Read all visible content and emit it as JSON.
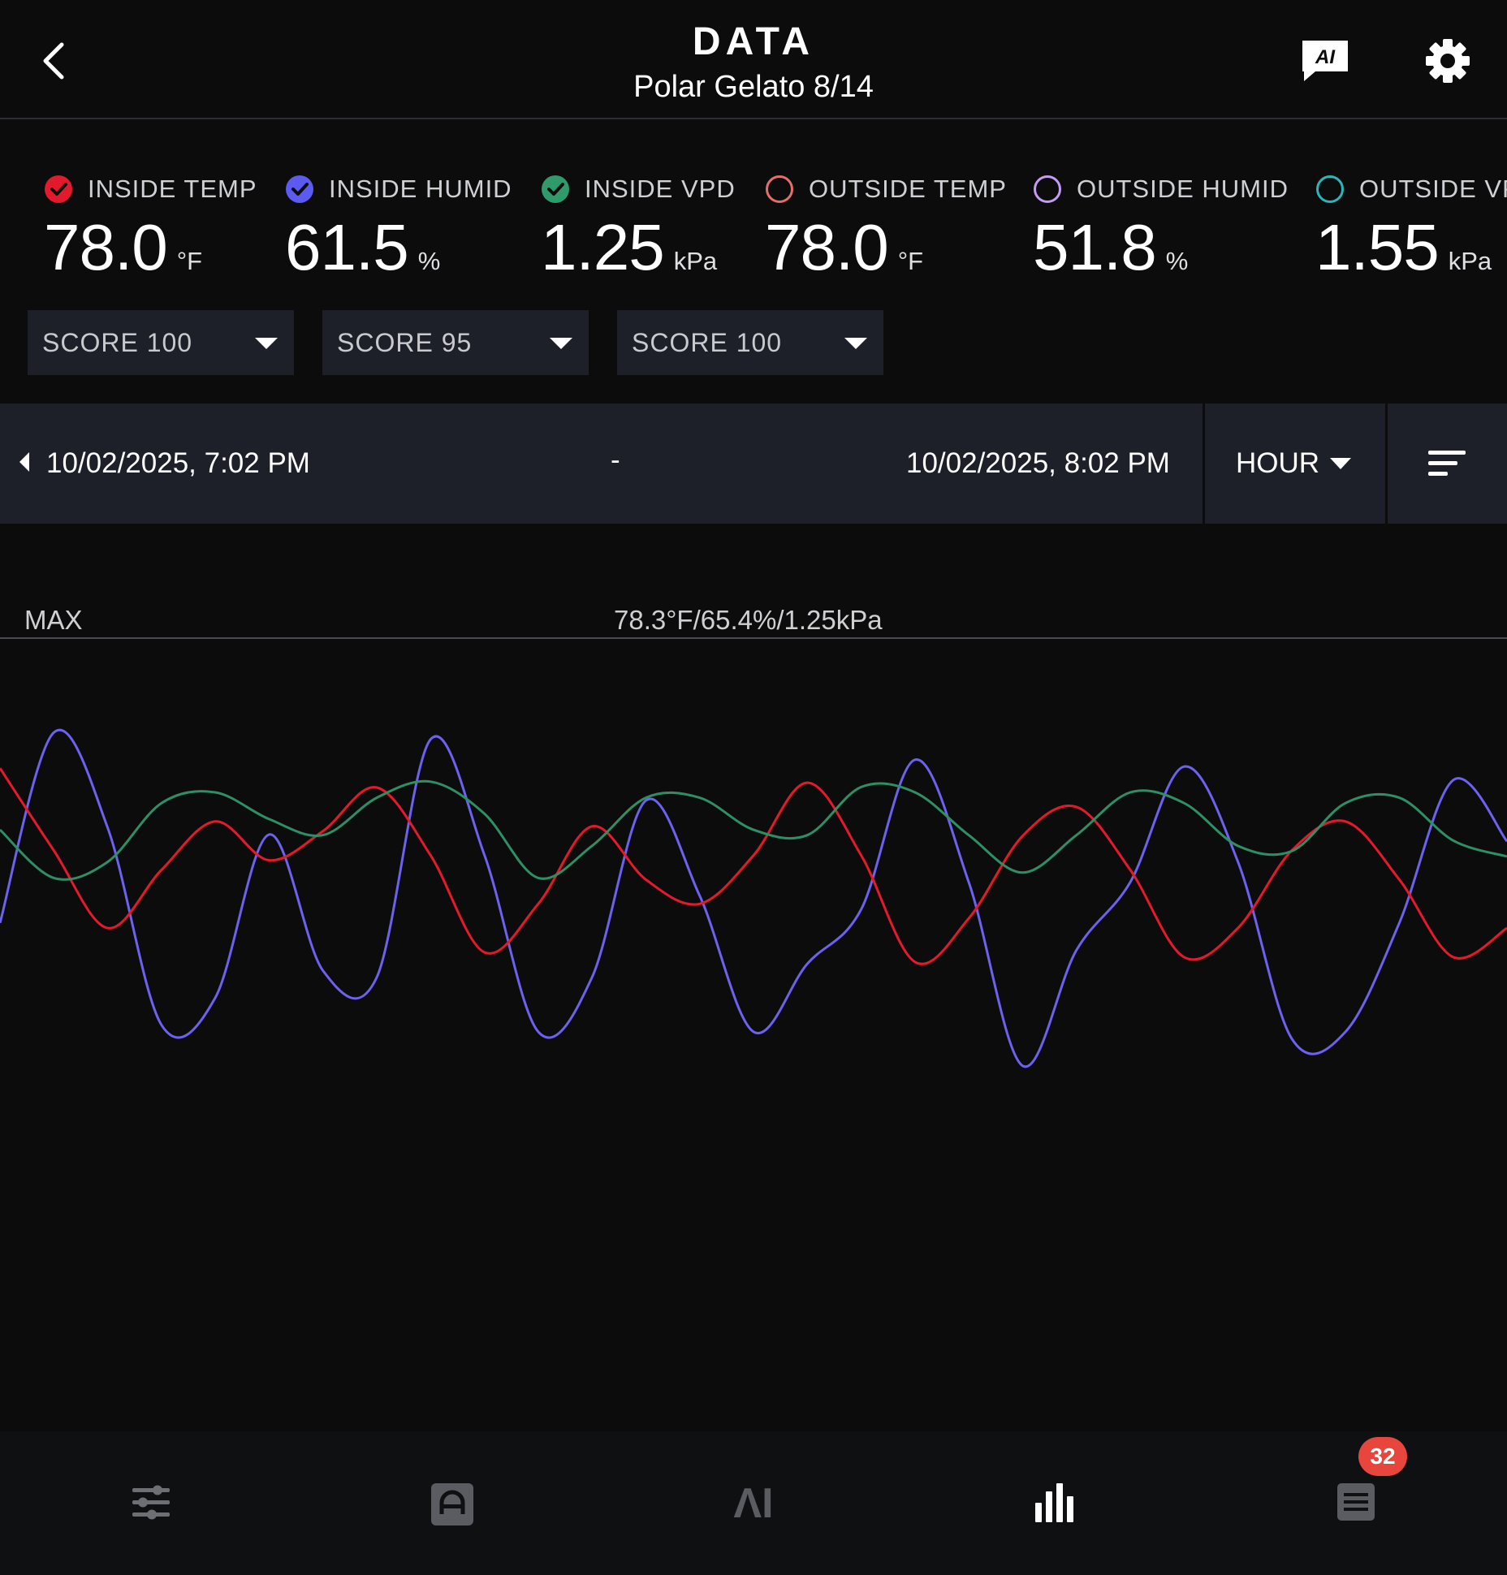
{
  "header": {
    "title": "DATA",
    "subtitle": "Polar Gelato 8/14"
  },
  "metrics": [
    {
      "label": "INSIDE TEMP",
      "value": "78.0",
      "unit": "°F",
      "color": "#e3192c",
      "checked": true
    },
    {
      "label": "INSIDE HUMID",
      "value": "61.5",
      "unit": "%",
      "color": "#5b5bef",
      "checked": true
    },
    {
      "label": "INSIDE VPD",
      "value": "1.25",
      "unit": "kPa",
      "color": "#2f9a6a",
      "checked": true
    },
    {
      "label": "OUTSIDE TEMP",
      "value": "78.0",
      "unit": "°F",
      "color": "#e36e6a",
      "checked": false
    },
    {
      "label": "OUTSIDE HUMID",
      "value": "51.8",
      "unit": "%",
      "color": "#c69bf2",
      "checked": false
    },
    {
      "label": "OUTSIDE VPD",
      "value": "1.55",
      "unit": "kPa",
      "color": "#2bb5b8",
      "checked": false
    }
  ],
  "scores": [
    "SCORE 100",
    "SCORE 95",
    "SCORE 100"
  ],
  "range": {
    "start": "10/02/2025, 7:02 PM",
    "separator": "-",
    "end": "10/02/2025, 8:02 PM",
    "period": "HOUR"
  },
  "chart_labels": {
    "max_label": "MAX",
    "max_value": "78.3°F/65.4%/1.25kPa"
  },
  "chart_data": {
    "type": "line",
    "xlabel": "",
    "ylabel": "",
    "grid": false,
    "legend": "none",
    "series": [
      {
        "name": "INSIDE HUMID",
        "color": "#6d62f0",
        "values": [
          62.0,
          64.8,
          63.4,
          60.5,
          60.9,
          63.3,
          61.3,
          61.2,
          64.7,
          63.0,
          60.4,
          61.2,
          63.8,
          62.4,
          60.4,
          61.4,
          62.2,
          64.4,
          62.6,
          59.9,
          61.6,
          62.6,
          64.3,
          62.9,
          60.3,
          60.4,
          62.0,
          64.1,
          63.2
        ]
      },
      {
        "name": "INSIDE TEMP",
        "color": "#e41a2c",
        "values": [
          78.03,
          77.86,
          77.7,
          77.82,
          77.92,
          77.84,
          77.9,
          77.99,
          77.85,
          77.65,
          77.75,
          77.91,
          77.8,
          77.75,
          77.85,
          78.0,
          77.85,
          77.63,
          77.72,
          77.89,
          77.95,
          77.82,
          77.64,
          77.7,
          77.86,
          77.92,
          77.8,
          77.64,
          77.7
        ]
      },
      {
        "name": "INSIDE VPD",
        "color": "#2e8f65",
        "values": [
          1.214,
          1.205,
          1.208,
          1.219,
          1.221,
          1.216,
          1.213,
          1.22,
          1.223,
          1.217,
          1.205,
          1.211,
          1.22,
          1.22,
          1.214,
          1.213,
          1.222,
          1.221,
          1.213,
          1.206,
          1.213,
          1.221,
          1.219,
          1.211,
          1.21,
          1.219,
          1.22,
          1.212,
          1.209
        ]
      }
    ],
    "ranges": {
      "INSIDE HUMID": [
        54.8,
        66.2
      ],
      "INSIDE TEMP": [
        76.7,
        78.3
      ],
      "INSIDE VPD": [
        1.105,
        1.25
      ]
    }
  },
  "nav": [
    {
      "name": "controls",
      "icon": "sliders-icon"
    },
    {
      "name": "automation",
      "icon": "a-square-icon"
    },
    {
      "name": "ai",
      "icon": "ai-icon"
    },
    {
      "name": "data",
      "icon": "bar-chart-icon",
      "active": true
    },
    {
      "name": "log",
      "icon": "list-icon",
      "badge": "32"
    }
  ]
}
